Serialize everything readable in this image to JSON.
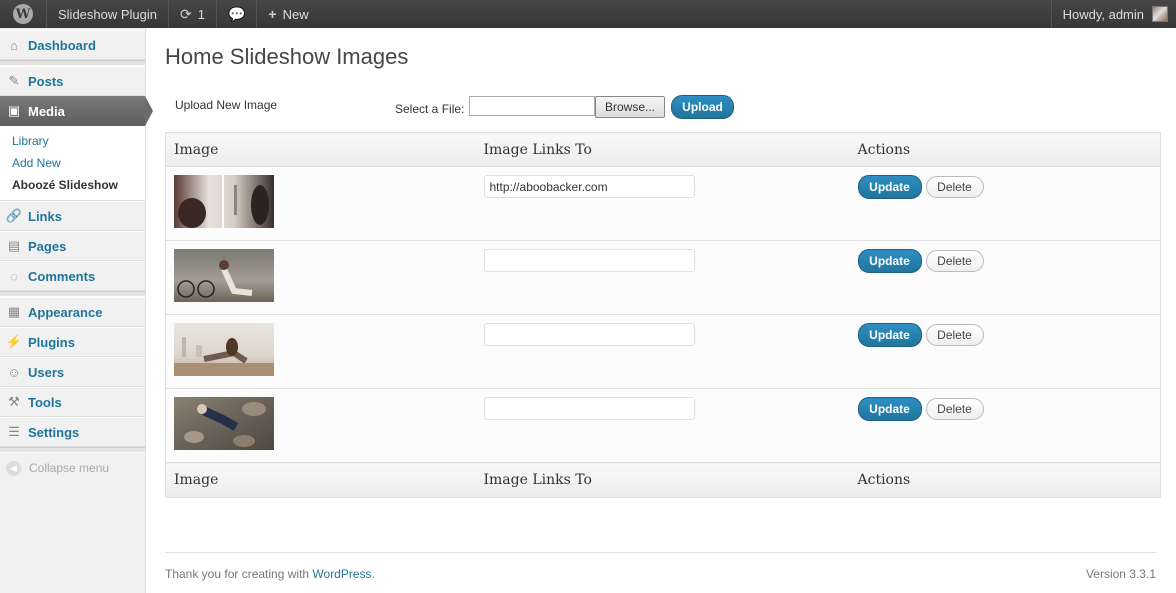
{
  "adminbar": {
    "site_name": "Slideshow Plugin",
    "updates_count": "1",
    "new_label": "New",
    "howdy": "Howdy, admin"
  },
  "sidebar": {
    "items": [
      {
        "label": "Dashboard",
        "icon": "dashboard-icon"
      },
      {
        "label": "Posts",
        "icon": "pin-icon"
      },
      {
        "label": "Media",
        "icon": "media-icon",
        "current": true
      },
      {
        "label": "Links",
        "icon": "link-icon"
      },
      {
        "label": "Pages",
        "icon": "pages-icon"
      },
      {
        "label": "Comments",
        "icon": "comment-icon"
      },
      {
        "label": "Appearance",
        "icon": "appearance-icon"
      },
      {
        "label": "Plugins",
        "icon": "plugin-icon"
      },
      {
        "label": "Users",
        "icon": "users-icon"
      },
      {
        "label": "Tools",
        "icon": "tools-icon"
      },
      {
        "label": "Settings",
        "icon": "settings-icon"
      }
    ],
    "media_submenu": [
      "Library",
      "Add New",
      "Aboozé Slideshow"
    ],
    "collapse_label": "Collapse menu"
  },
  "main": {
    "title": "Home Slideshow Images",
    "upload_label": "Upload New Image",
    "select_file_label": "Select a File:",
    "browse_label": "Browse...",
    "upload_button": "Upload",
    "table": {
      "headers": [
        "Image",
        "Image Links To",
        "Actions"
      ],
      "rows": [
        {
          "link": "http://aboobacker.com"
        },
        {
          "link": ""
        },
        {
          "link": ""
        },
        {
          "link": ""
        }
      ],
      "update_label": "Update",
      "delete_label": "Delete"
    }
  },
  "footer": {
    "thanks_text": "Thank you for creating with ",
    "wordpress_link": "WordPress",
    "period": ".",
    "version": "Version 3.3.1"
  },
  "colors": {
    "accent": "#21759b",
    "adminbar": "#464646",
    "sidebar_current": "#6a6a6a"
  }
}
